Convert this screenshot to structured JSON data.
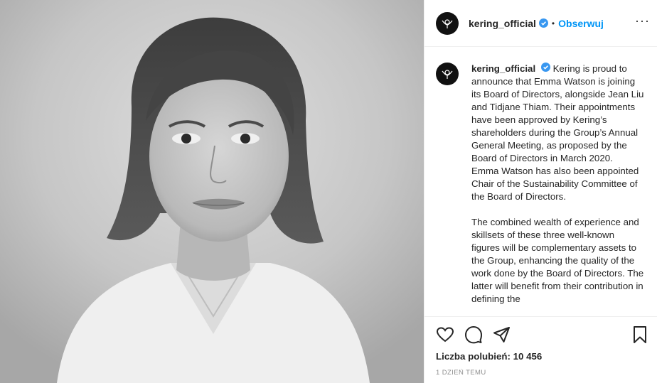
{
  "post": {
    "photo_alt": "",
    "header": {
      "username": "kering_official",
      "dot": "•",
      "follow_label": "Obserwuj",
      "more": "···"
    },
    "caption": {
      "username": "kering_official",
      "paragraph1": "Kering is proud to announce that Emma Watson is joining its Board of Directors, alongside Jean Liu and Tidjane Thiam. Their appointments have been approved by Kering’s shareholders during the Group’s Annual General Meeting, as proposed by the Board of Directors in March 2020.",
      "paragraph2": "Emma Watson has also been appointed Chair of the Sustainability Committee of the Board of Directors.",
      "paragraph3": "The combined wealth of experience and skillsets of these three well-known figures will be complementary assets to the Group, enhancing the quality of the work done by the Board of Directors. The latter will benefit from their contribution in defining the"
    },
    "likes_text": "Liczba polubień: 10 456",
    "time_text": "1 dzień temu"
  },
  "icons": {
    "like": "heart-icon",
    "comment": "comment-icon",
    "share": "share-icon",
    "save": "bookmark-icon",
    "verified": "verified-badge-icon"
  },
  "colors": {
    "accent": "#0095f6",
    "verified": "#3897f0",
    "text": "#262626",
    "muted": "#8e8e8e"
  }
}
